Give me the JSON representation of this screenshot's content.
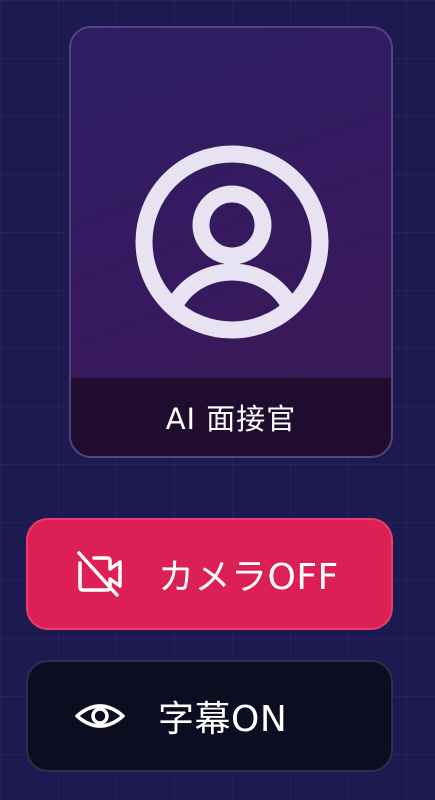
{
  "interviewer": {
    "name": "AI 面接官",
    "avatar_icon": "user-circle-icon"
  },
  "controls": {
    "camera": {
      "label": "カメラOFF",
      "icon": "camera-off-icon",
      "color": "#dc2055"
    },
    "captions": {
      "label": "字幕ON",
      "icon": "eye-icon",
      "color": "#0d0d22"
    }
  },
  "colors": {
    "background": "#1d1a52",
    "card": "#2c1f63",
    "name_bar": "#200c2e"
  }
}
